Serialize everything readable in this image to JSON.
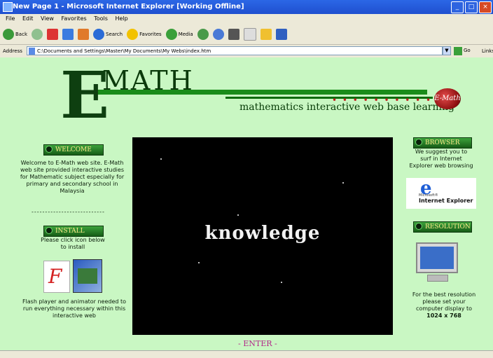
{
  "window": {
    "title": "New Page 1 - Microsoft Internet Explorer [Working Offline]",
    "controls": {
      "minimize": "_",
      "maximize": "□",
      "close": "×"
    }
  },
  "menu": [
    "File",
    "Edit",
    "View",
    "Favorites",
    "Tools",
    "Help"
  ],
  "toolbar": {
    "back": "Back",
    "search": "Search",
    "favorites": "Favorites",
    "media": "Media"
  },
  "address": {
    "label": "Address",
    "url": "C:\\Documents and Settings\\Master\\My Documents\\My Webs\\index.htm",
    "go": "Go",
    "links": "Links"
  },
  "site": {
    "logo_e": "E",
    "logo_math": "MATH",
    "dots": "• • • • • • • • • •",
    "tagline": "mathematics interactive web base learning",
    "logo_badge": "E-Math"
  },
  "left": {
    "welcome_title": "WELCOME",
    "welcome_text": "Welcome to E-Math web site. E-Math web site provided interactive studies for Mathematic subject especially for primary and secondary school in Malaysia",
    "divider": "---------------------------",
    "install_title": "INSTALL",
    "install_text": "Please click icon below to install",
    "flash_text": "Flash player and animator needed to run everything necessary within this interactive web"
  },
  "center": {
    "word": "knowledge",
    "enter": "- ENTER -"
  },
  "right": {
    "browser_title": "BROWSER",
    "browser_text": "We suggest you to surf in Internet Explorer web browsing",
    "ie_ms": "Microsoft®",
    "ie_e": "e",
    "ie_name": "Internet Explorer",
    "resolution_title": "RESOLUTION",
    "resolution_text": "For the best resolution please set your computer display to",
    "resolution_value": "1024 x 768"
  },
  "icons": {
    "flash": "F"
  }
}
